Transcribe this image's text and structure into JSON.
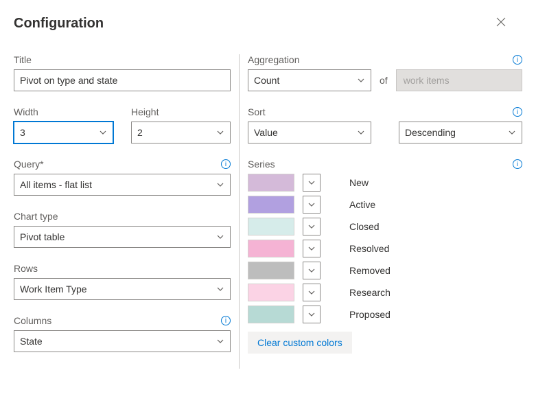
{
  "header": {
    "title": "Configuration"
  },
  "left": {
    "title": {
      "label": "Title",
      "value": "Pivot on type and state"
    },
    "width": {
      "label": "Width",
      "value": "3"
    },
    "height": {
      "label": "Height",
      "value": "2"
    },
    "query": {
      "label": "Query*",
      "value": "All items - flat list"
    },
    "chart_type": {
      "label": "Chart type",
      "value": "Pivot table"
    },
    "rows": {
      "label": "Rows",
      "value": "Work Item Type"
    },
    "columns": {
      "label": "Columns",
      "value": "State"
    }
  },
  "right": {
    "aggregation": {
      "label": "Aggregation",
      "value": "Count",
      "of_text": "of",
      "target": "work items"
    },
    "sort": {
      "label": "Sort",
      "value": "Value",
      "direction": "Descending"
    },
    "series": {
      "label": "Series",
      "items": [
        {
          "name": "New",
          "color": "#d4bad9"
        },
        {
          "name": "Active",
          "color": "#b1a0e0"
        },
        {
          "name": "Closed",
          "color": "#d6ecea"
        },
        {
          "name": "Resolved",
          "color": "#f5b3d4"
        },
        {
          "name": "Removed",
          "color": "#bdbdbd"
        },
        {
          "name": "Research",
          "color": "#fbd3e5"
        },
        {
          "name": "Proposed",
          "color": "#b7dad5"
        }
      ],
      "clear_label": "Clear custom colors"
    }
  }
}
